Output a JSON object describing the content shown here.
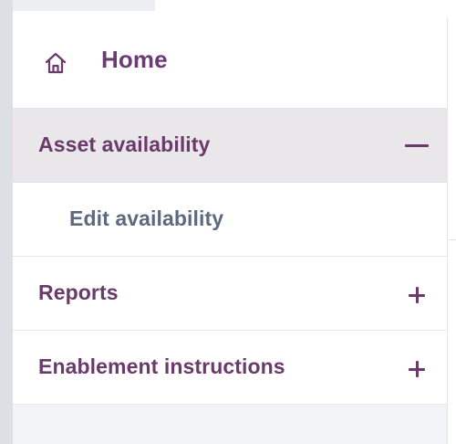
{
  "nav": {
    "home": {
      "label": "Home",
      "icon": "home-icon"
    },
    "asset_availability": {
      "label": "Asset availability",
      "expanded": true,
      "toggle_icon": "minus-icon"
    },
    "edit_availability": {
      "label": "Edit availability"
    },
    "reports": {
      "label": "Reports",
      "expanded": false,
      "toggle_icon": "plus-icon"
    },
    "enablement_instructions": {
      "label": "Enablement instructions",
      "expanded": false,
      "toggle_icon": "plus-icon"
    }
  },
  "colors": {
    "accent": "#6a3a6a",
    "active_bg": "#eae7eb",
    "sub_text": "#5b6a7f",
    "divider": "#e6e7ea"
  }
}
